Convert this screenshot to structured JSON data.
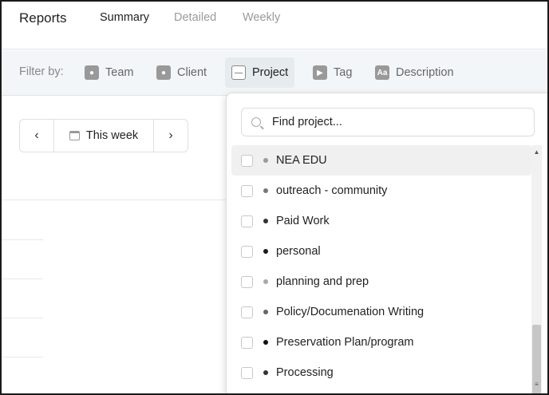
{
  "header": {
    "title": "Reports",
    "tabs": [
      "Summary",
      "Detailed",
      "Weekly"
    ]
  },
  "filterbar": {
    "label": "Filter by:",
    "filters": [
      {
        "label": "Team",
        "icon": "team-icon"
      },
      {
        "label": "Client",
        "icon": "client-icon"
      },
      {
        "label": "Project",
        "icon": "project-icon"
      },
      {
        "label": "Tag",
        "icon": "tag-icon"
      },
      {
        "label": "Description",
        "icon": "description-icon",
        "glyph": "Aa"
      }
    ]
  },
  "daterange": {
    "prev": "‹",
    "label": "This week",
    "next": "›"
  },
  "dropdown": {
    "search_placeholder": "Find project...",
    "items": [
      {
        "label": "NEA EDU",
        "dot": "#9a9a9a"
      },
      {
        "label": "outreach - community",
        "dot": "#777777"
      },
      {
        "label": "Paid Work",
        "dot": "#333333"
      },
      {
        "label": "personal",
        "dot": "#1a1a1a"
      },
      {
        "label": "planning and prep",
        "dot": "#a8a8a8"
      },
      {
        "label": "Policy/Documenation Writing",
        "dot": "#666666"
      },
      {
        "label": "Preservation Plan/program",
        "dot": "#111111"
      },
      {
        "label": "Processing",
        "dot": "#333333"
      }
    ]
  }
}
